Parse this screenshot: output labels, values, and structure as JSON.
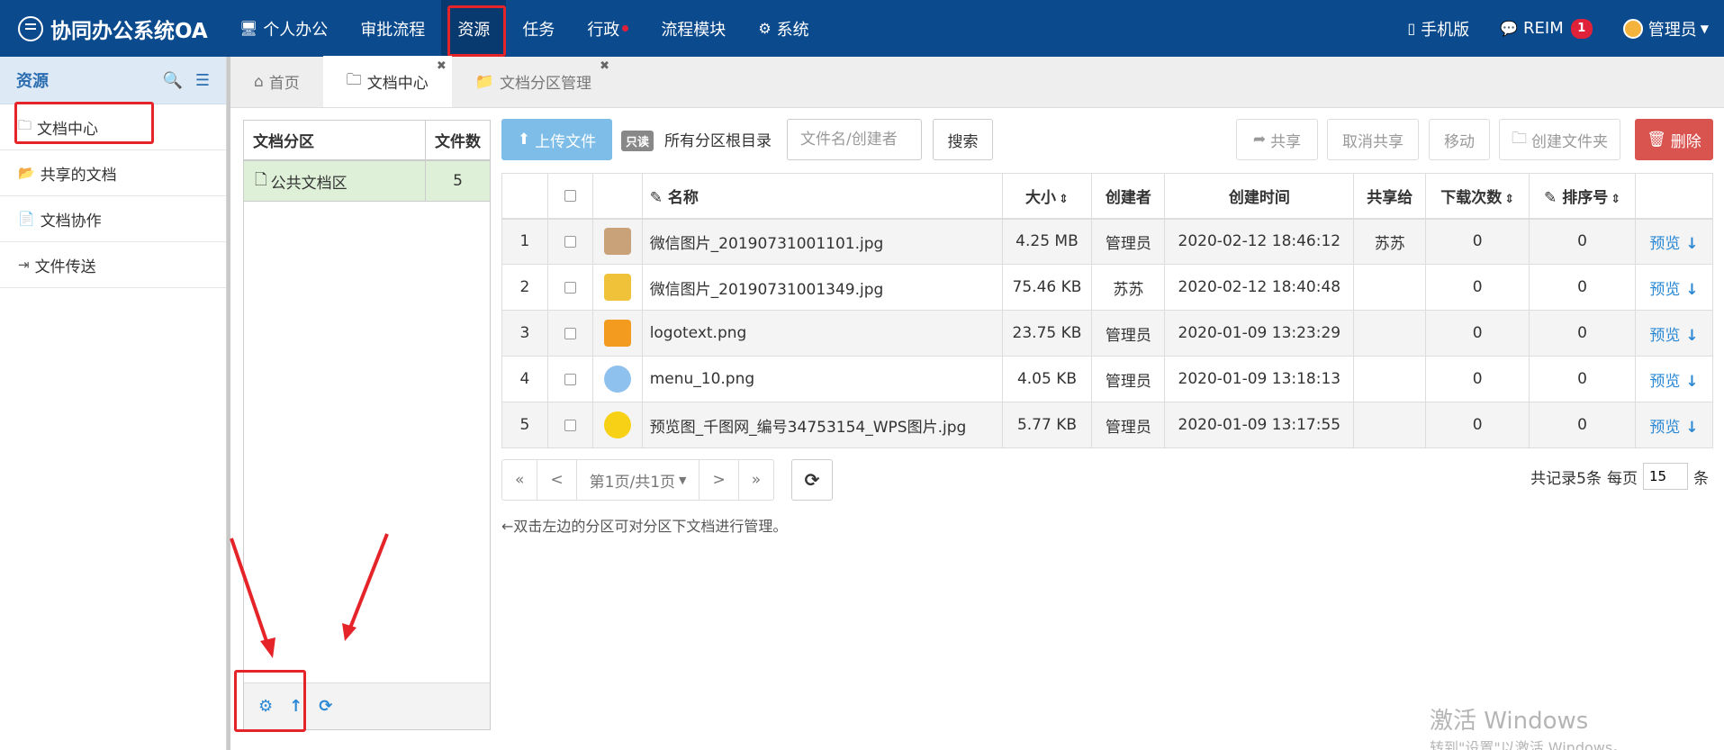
{
  "app": {
    "title": "协同办公系统OA"
  },
  "top_nav": [
    {
      "label": "个人办公",
      "icon": "monitor-icon"
    },
    {
      "label": "审批流程"
    },
    {
      "label": "资源",
      "active": true
    },
    {
      "label": "任务"
    },
    {
      "label": "行政",
      "dot": true
    },
    {
      "label": "流程模块"
    },
    {
      "label": "系统",
      "icon": "gear-icon"
    }
  ],
  "top_right": {
    "mobile": "手机版",
    "reim": "REIM",
    "reim_badge": "1",
    "user": "管理员"
  },
  "sidebar": {
    "title": "资源",
    "items": [
      {
        "label": "文档中心"
      },
      {
        "label": "共享的文档"
      },
      {
        "label": "文档协作"
      },
      {
        "label": "文件传送"
      }
    ]
  },
  "tabs": [
    {
      "label": "首页"
    },
    {
      "label": "文档中心",
      "active": true
    },
    {
      "label": "文档分区管理"
    }
  ],
  "partition": {
    "col_name": "文档分区",
    "col_count": "文件数",
    "rows": [
      {
        "name": "公共文档区",
        "count": "5"
      }
    ]
  },
  "toolbar": {
    "upload": "上传文件",
    "readonly": "只读",
    "root": "所有分区根目录",
    "search_placeholder": "文件名/创建者",
    "search": "搜索",
    "share": "共享",
    "unshare": "取消共享",
    "move": "移动",
    "mkdir": "创建文件夹",
    "delete": "删除"
  },
  "table": {
    "headers": {
      "name": "名称",
      "size": "大小",
      "creator": "创建者",
      "created": "创建时间",
      "shared_to": "共享给",
      "downloads": "下载次数",
      "order": "排序号"
    },
    "rows": [
      {
        "idx": "1",
        "name": "微信图片_20190731001101.jpg",
        "size": "4.25 MB",
        "creator": "管理员",
        "created": "2020-02-12 18:46:12",
        "shared_to": "苏苏",
        "downloads": "0",
        "order": "0",
        "action": "预览"
      },
      {
        "idx": "2",
        "name": "微信图片_20190731001349.jpg",
        "size": "75.46 KB",
        "creator": "苏苏",
        "created": "2020-02-12 18:40:48",
        "shared_to": "",
        "downloads": "0",
        "order": "0",
        "action": "预览"
      },
      {
        "idx": "3",
        "name": "logotext.png",
        "size": "23.75 KB",
        "creator": "管理员",
        "created": "2020-01-09 13:23:29",
        "shared_to": "",
        "downloads": "0",
        "order": "0",
        "action": "预览"
      },
      {
        "idx": "4",
        "name": "menu_10.png",
        "size": "4.05 KB",
        "creator": "管理员",
        "created": "2020-01-09 13:18:13",
        "shared_to": "",
        "downloads": "0",
        "order": "0",
        "action": "预览"
      },
      {
        "idx": "5",
        "name": "预览图_千图网_编号34753154_WPS图片.jpg",
        "size": "5.77 KB",
        "creator": "管理员",
        "created": "2020-01-09 13:17:55",
        "shared_to": "",
        "downloads": "0",
        "order": "0",
        "action": "预览"
      }
    ],
    "thumb_colors": [
      "#c9a27a",
      "#f0c23a",
      "#f29b1f",
      "#8ec1ee",
      "#f7d116"
    ]
  },
  "pager": {
    "first": "«",
    "prev": "<",
    "page": "第1页/共1页",
    "next": ">",
    "last": "»",
    "records": "共记录5条",
    "per_page_label": "每页",
    "per_page": "15",
    "unit": "条"
  },
  "hint": "←双击左边的分区可对分区下文档进行管理。",
  "watermark": {
    "line1": "激活 Windows",
    "line2": "转到\"设置\"以激活 Windows。"
  },
  "colors": {
    "topbar": "#0b4a8c",
    "accent": "#2a88d4",
    "highlight": "#e5242a",
    "danger": "#d9534f"
  }
}
